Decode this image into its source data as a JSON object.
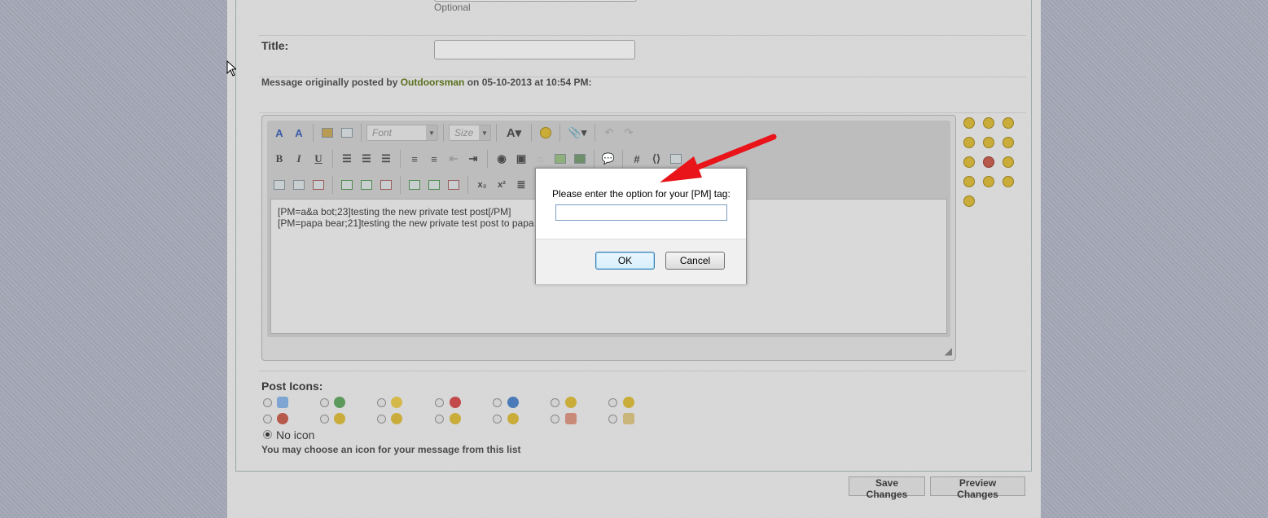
{
  "form": {
    "optional_note": "Optional",
    "title_label": "Title:",
    "message_original": {
      "prefix": "Message originally posted by ",
      "author": "Outdoorsman",
      "suffix": " on 05-10-2013 at 10:54 PM:"
    }
  },
  "editor": {
    "font_placeholder": "Font",
    "size_placeholder": "Size",
    "bold": "B",
    "italic": "I",
    "underline": "U",
    "text_lines": [
      "[PM=a&a bot;23]testing the new private test post[/PM]",
      "[PM=papa bear;21]testing the new private test post to papa b"
    ]
  },
  "post_icons": {
    "label": "Post Icons:",
    "no_icon_label": "No icon",
    "note": "You may choose an icon for your message from this list"
  },
  "buttons": {
    "save": "Save Changes",
    "preview": "Preview Changes"
  },
  "dialog": {
    "message": "Please enter the option for your [PM] tag:",
    "input_value": "",
    "ok": "OK",
    "cancel": "Cancel"
  },
  "colors": {
    "author_link": "#5a6f1e",
    "annotation_arrow": "#e8141a",
    "ok_button_border": "#3c7fb1"
  }
}
